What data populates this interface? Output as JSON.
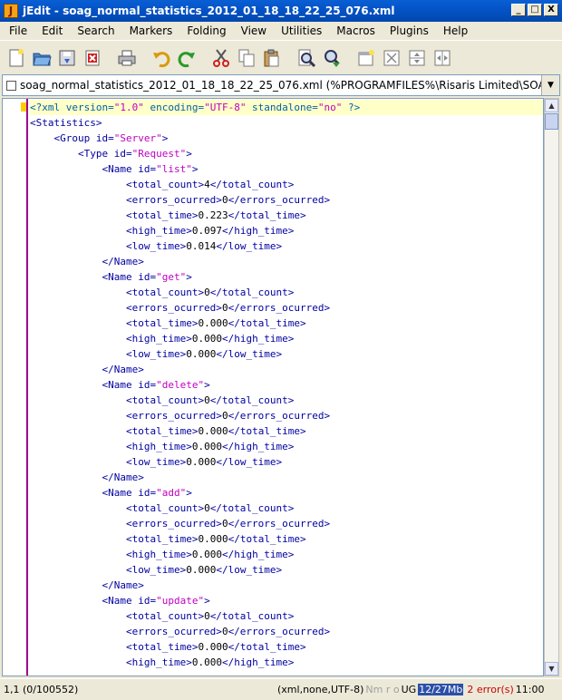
{
  "window": {
    "title": "jEdit - soag_normal_statistics_2012_01_18_18_22_25_076.xml",
    "app_logo": "J",
    "buttons": [
      "_",
      "□",
      "X"
    ]
  },
  "menu": [
    "File",
    "Edit",
    "Search",
    "Markers",
    "Folding",
    "View",
    "Utilities",
    "Macros",
    "Plugins",
    "Help"
  ],
  "toolbar": {
    "icons": [
      "new-file-icon",
      "open-file-icon",
      "save-icon",
      "close-file-icon",
      "print-icon",
      "undo-icon",
      "redo-icon",
      "cut-icon",
      "copy-icon",
      "paste-icon",
      "find-icon",
      "find-next-icon",
      "new-view-icon",
      "unsplit-icon",
      "split-horizontal-icon",
      "split-vertical-icon"
    ]
  },
  "buffer": {
    "name": "soag_normal_statistics_2012_01_18_18_22_25_076.xml (%PROGRAMFILES%\\Risaris Limited\\SOA ..."
  },
  "code_lines": [
    "<?xml version=\"1.0\" encoding=\"UTF-8\" standalone=\"no\" ?>",
    "<Statistics>",
    "    <Group id=\"Server\">",
    "        <Type id=\"Request\">",
    "            <Name id=\"list\">",
    "                <total_count>4</total_count>",
    "                <errors_ocurred>0</errors_ocurred>",
    "                <total_time>0.223</total_time>",
    "                <high_time>0.097</high_time>",
    "                <low_time>0.014</low_time>",
    "            </Name>",
    "            <Name id=\"get\">",
    "                <total_count>0</total_count>",
    "                <errors_ocurred>0</errors_ocurred>",
    "                <total_time>0.000</total_time>",
    "                <high_time>0.000</high_time>",
    "                <low_time>0.000</low_time>",
    "            </Name>",
    "            <Name id=\"delete\">",
    "                <total_count>0</total_count>",
    "                <errors_ocurred>0</errors_ocurred>",
    "                <total_time>0.000</total_time>",
    "                <high_time>0.000</high_time>",
    "                <low_time>0.000</low_time>",
    "            </Name>",
    "            <Name id=\"add\">",
    "                <total_count>0</total_count>",
    "                <errors_ocurred>0</errors_ocurred>",
    "                <total_time>0.000</total_time>",
    "                <high_time>0.000</high_time>",
    "                <low_time>0.000</low_time>",
    "            </Name>",
    "            <Name id=\"update\">",
    "                <total_count>0</total_count>",
    "                <errors_ocurred>0</errors_ocurred>",
    "                <total_time>0.000</total_time>",
    "                <high_time>0.000</high_time>"
  ],
  "status": {
    "caret": "1,1 (0/100552)",
    "mode": "(xml,none,UTF-8)",
    "flags": "Nm r o",
    "ug": "UG",
    "memory": "12/27Mb",
    "errors": "2 error(s)",
    "time": "11:00"
  },
  "colors": {
    "tag": "#0000a0",
    "attr_value": "#c000c0",
    "current_line": "#ffffc8",
    "gutter_border": "#a0008c"
  }
}
